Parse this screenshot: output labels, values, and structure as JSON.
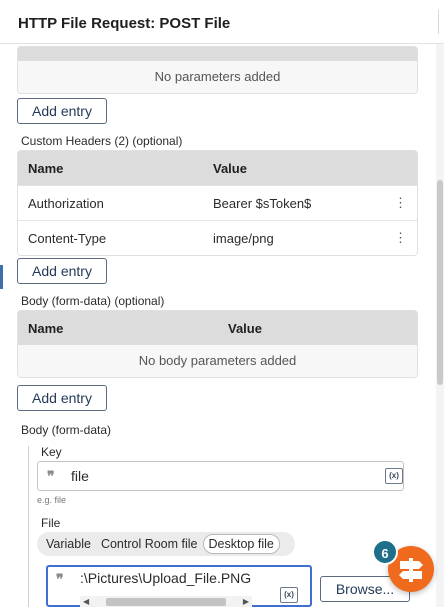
{
  "header": {
    "title": "HTTP File Request: POST File"
  },
  "parameters": {
    "empty_text": "No parameters added",
    "add_label": "Add entry"
  },
  "custom_headers": {
    "label": "Custom Headers (2) (optional)",
    "columns": [
      "Name",
      "Value"
    ],
    "rows": [
      {
        "name": "Authorization",
        "value": "Bearer $sToken$"
      },
      {
        "name": "Content-Type",
        "value": "image/png"
      }
    ],
    "row_menu_icon": "⋮",
    "add_label": "Add entry"
  },
  "body_optional": {
    "label": "Body (form-data) (optional)",
    "columns": [
      "Name",
      "Value"
    ],
    "empty_text": "No body parameters added",
    "add_label": "Add entry"
  },
  "body": {
    "label": "Body (form-data)",
    "key_label": "Key",
    "key_value": "file",
    "key_hint": "e.g. file",
    "var_button": "(x)",
    "quote_icon": "❞",
    "file_label": "File",
    "file_sources": [
      "Variable",
      "Control Room file",
      "Desktop file"
    ],
    "selected_source": "Desktop file",
    "file_value": ":\\Pictures\\Upload_File.PNG",
    "browse_label": "Browse..."
  },
  "help": {
    "badge_count": "6",
    "icon": "signpost-icon"
  }
}
